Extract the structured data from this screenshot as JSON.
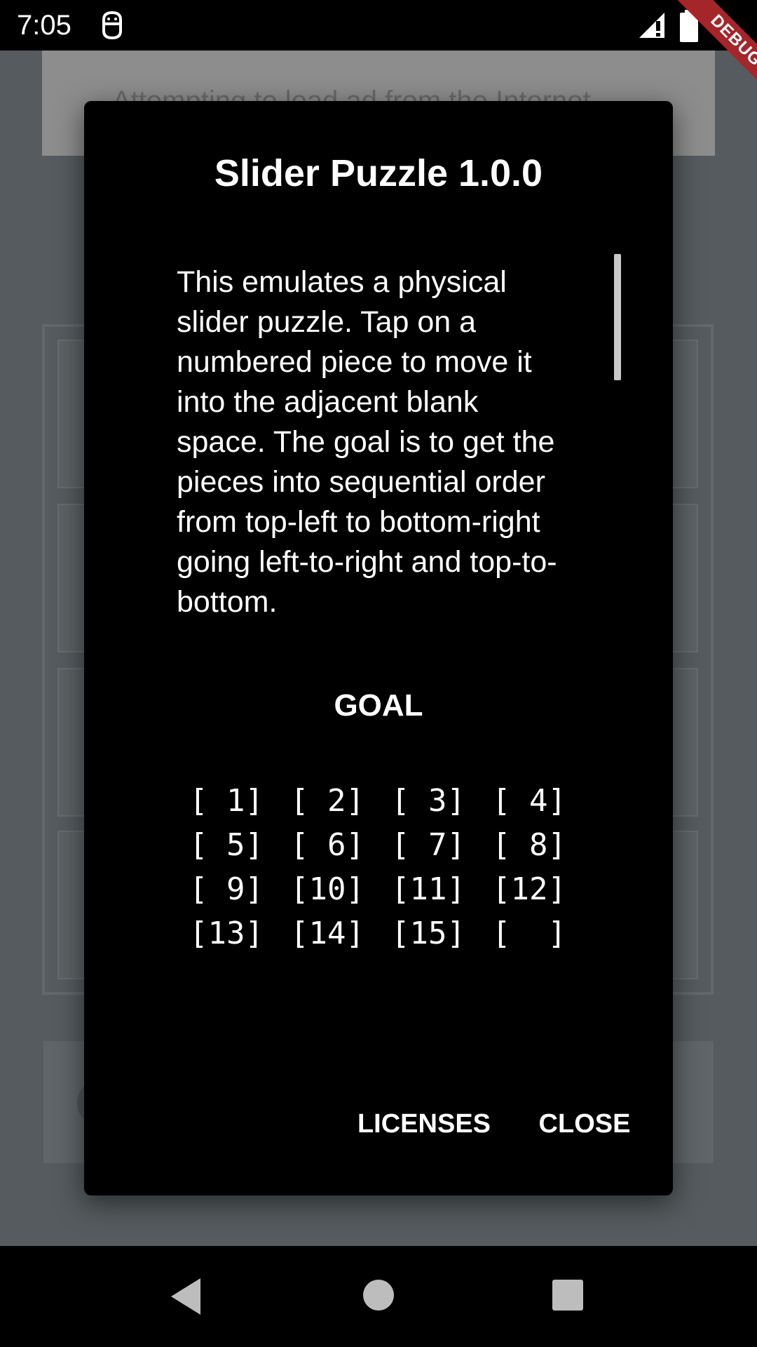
{
  "status_bar": {
    "time": "7:05",
    "app_icon": "android-debug-icon",
    "signal_icon": "cell-signal-icon",
    "battery_icon": "battery-icon"
  },
  "debug_banner": "DEBUG",
  "background": {
    "banner_text": "Attempting to load ad from the Internet..."
  },
  "dialog": {
    "title": "Slider Puzzle 1.0.0",
    "body": "This emulates a physical slider puzzle. Tap on a numbered piece to move it into the adjacent blank space. The goal is to get the pieces into sequential order from top-left to bottom-right going left-to-right and top-to-bottom.",
    "goal_heading": "GOAL",
    "goal_grid": [
      "[ 1]",
      "[ 2]",
      "[ 3]",
      "[ 4]",
      "[ 5]",
      "[ 6]",
      "[ 7]",
      "[ 8]",
      "[ 9]",
      "[10]",
      "[11]",
      "[12]",
      "[13]",
      "[14]",
      "[15]",
      "[  ]"
    ],
    "buttons": {
      "licenses": "LICENSES",
      "close": "CLOSE"
    }
  },
  "nav_bar": {
    "back_icon": "back-triangle-icon",
    "home_icon": "home-circle-icon",
    "recents_icon": "recents-square-icon"
  },
  "colors": {
    "scrim": "#555b5e",
    "dialog_bg": "#000000",
    "debug_banner": "#a4252a"
  }
}
